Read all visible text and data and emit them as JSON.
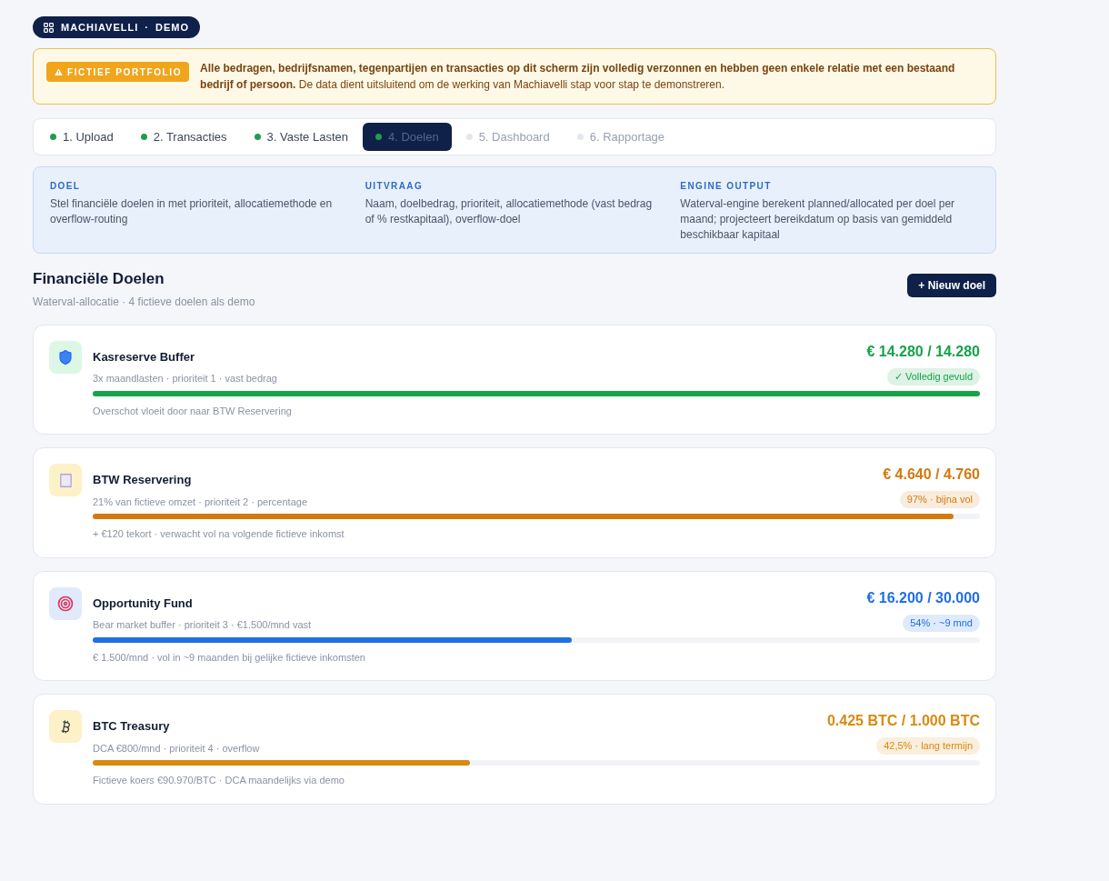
{
  "brand_badge": {
    "label": "MACHIAVELLI · DEMO"
  },
  "notice": {
    "tag": "FICTIEF PORTFOLIO",
    "text": "**Alle bedragen, bedrijfsnamen, tegenpartijen en transacties op dit scherm zijn volledig verzonnen en hebben geen enkele relatie met een bestaand bedrijf of persoon.** De data dient uitsluitend om de werking van Machiavelli stap voor stap te demonstreren."
  },
  "steps": [
    {
      "label": "1. Upload",
      "completed": true,
      "selected": false
    },
    {
      "label": "2. Transacties",
      "completed": true,
      "selected": false
    },
    {
      "label": "3. Vaste Lasten",
      "completed": true,
      "selected": false
    },
    {
      "label": "4. Doelen",
      "completed": true,
      "selected": true
    },
    {
      "label": "5. Dashboard",
      "completed": false,
      "selected": false
    },
    {
      "label": "6. Rapportage",
      "completed": false,
      "selected": false
    }
  ],
  "info_panel": [
    {
      "heading": "DOEL",
      "text": "Stel financiële doelen in met prioriteit, allocatiemethode en overflow-routing"
    },
    {
      "heading": "UITVRAAG",
      "text": "Naam, doelbedrag, prioriteit, allocatiemethode (vast bedrag of % restkapitaal), overflow-doel"
    },
    {
      "heading": "ENGINE OUTPUT",
      "text": "Waterval-engine berekent planned/allocated per doel per maand; projecteert bereikdatum op basis van gemiddeld beschikbaar kapitaal"
    }
  ],
  "section": {
    "title": "Financiële Doelen",
    "subtitle": "Waterval-allocatie · 4 fictieve doelen als demo",
    "button": "+ Nieuw doel"
  },
  "goals": [
    {
      "kind": "shield",
      "color": "#16a34a",
      "name": "Kasreserve Buffer",
      "details": "3x maandlasten · prioriteit 1 · vast bedrag",
      "amount": "€ 14.280 / 14.280",
      "status": "✓ Volledig gevuld",
      "level": 1.0,
      "note": "Overschot vloeit door naar BTW Reservering"
    },
    {
      "kind": "receipt",
      "color": "#d4790f",
      "name": "BTW Reservering",
      "details": "21% van fictieve omzet · prioriteit 2 · percentage",
      "amount": "€ 4.640 / 4.760",
      "status": "97% · bijna vol",
      "level": 0.97,
      "note": "+ €120 tekort · verwacht vol na volgende fictieve inkomst"
    },
    {
      "kind": "target",
      "color": "#1f6fe5",
      "name": "Opportunity Fund",
      "details": "Bear market buffer · prioriteit 3 · €1.500/mnd vast",
      "amount": "€ 16.200 / 30.000",
      "status": "54% · ~9 mnd",
      "level": 0.54,
      "note": "€ 1.500/mnd · vol in ~9 maanden bij gelijke fictieve inkomsten"
    },
    {
      "kind": "bitcoin",
      "color": "#d98a0f",
      "name": "BTC Treasury",
      "details": "DCA €800/mnd · prioriteit 4 · overflow",
      "amount": "0.425 BTC / 1.000 BTC",
      "status": "42,5% · lang termijn",
      "level": 0.425,
      "note": "Fictieve koers €90.970/BTC · DCA maandelijks via demo"
    }
  ]
}
